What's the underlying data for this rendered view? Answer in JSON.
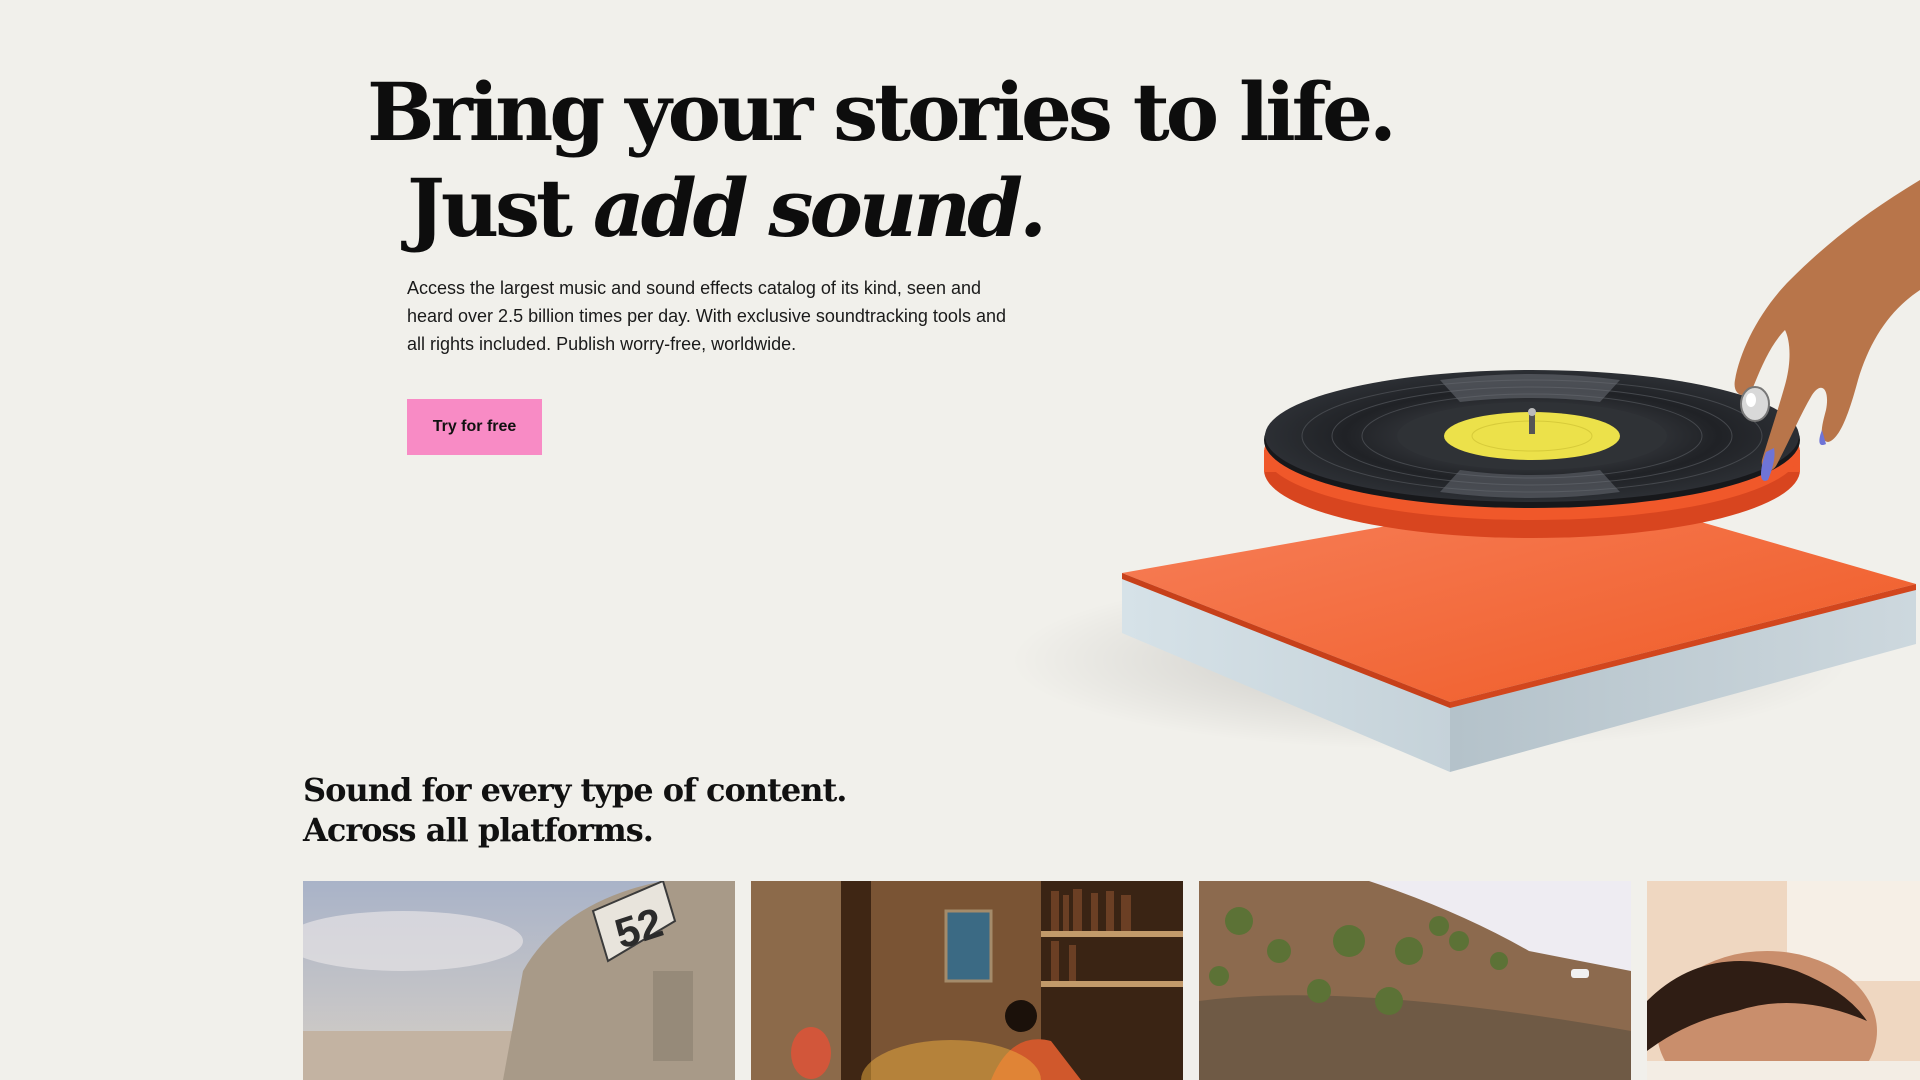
{
  "hero": {
    "title_line1": "Bring your stories to life.",
    "title_line2_plain": "Just ",
    "title_line2_italic": "add sound.",
    "description": "Access the largest music and sound effects catalog of its kind, seen and heard over 2.5 billion times per day. With exclusive soundtracking tools and all rights included. Publish worry-free, worldwide.",
    "cta_label": "Try for free"
  },
  "section": {
    "title_line1": "Sound for every type of content.",
    "title_line2": "Across all platforms."
  },
  "cards": {
    "card1_number": "52"
  },
  "colors": {
    "background": "#f1f0eb",
    "cta": "#f88bc5",
    "turntable_top": "#f2622f",
    "turntable_side": "#cdd8de",
    "record_label": "#ece14a"
  }
}
